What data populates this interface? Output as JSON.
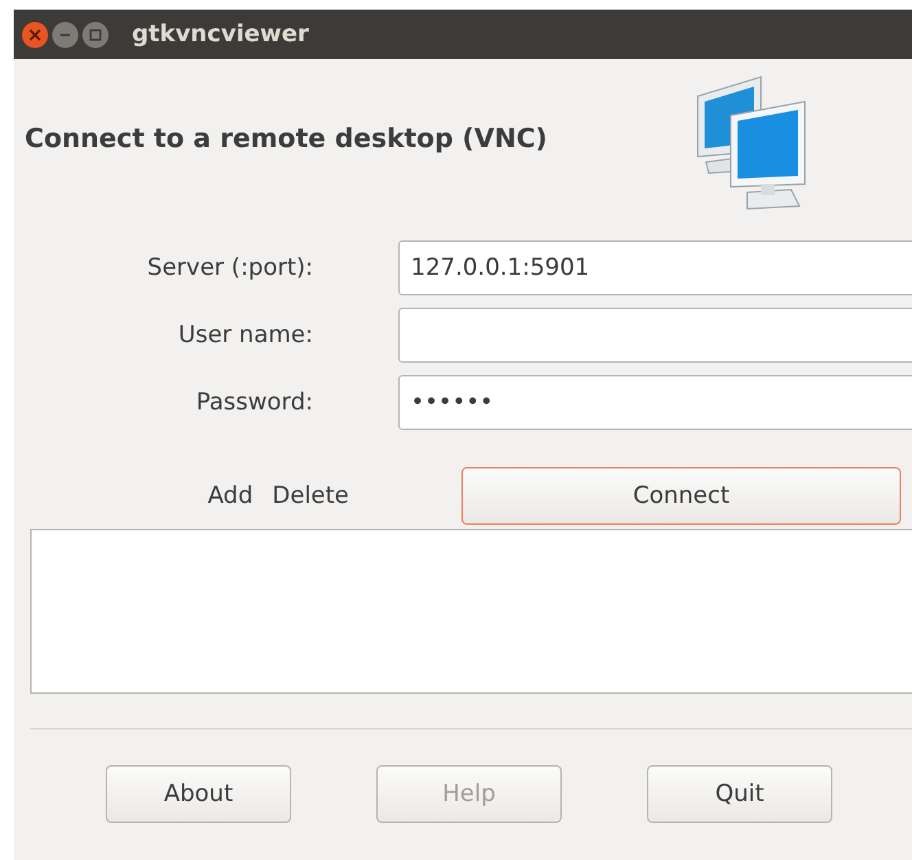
{
  "window": {
    "title": "gtkvncviewer"
  },
  "heading": "Connect to a remote desktop (VNC)",
  "fields": [
    {
      "label": "Server (:port):",
      "value": "127.0.0.1:5901"
    },
    {
      "label": "User name:"
    },
    {
      "label": "Password:",
      "value": "••••••"
    }
  ],
  "list_actions": [
    "Add",
    "Delete"
  ],
  "connect_button": {
    "label": "Connect",
    "focused": true
  },
  "buttons": [
    {
      "label": "About",
      "disabled": false
    },
    {
      "label": "Help",
      "disabled": true
    },
    {
      "label": "Quit",
      "disabled": false
    }
  ]
}
